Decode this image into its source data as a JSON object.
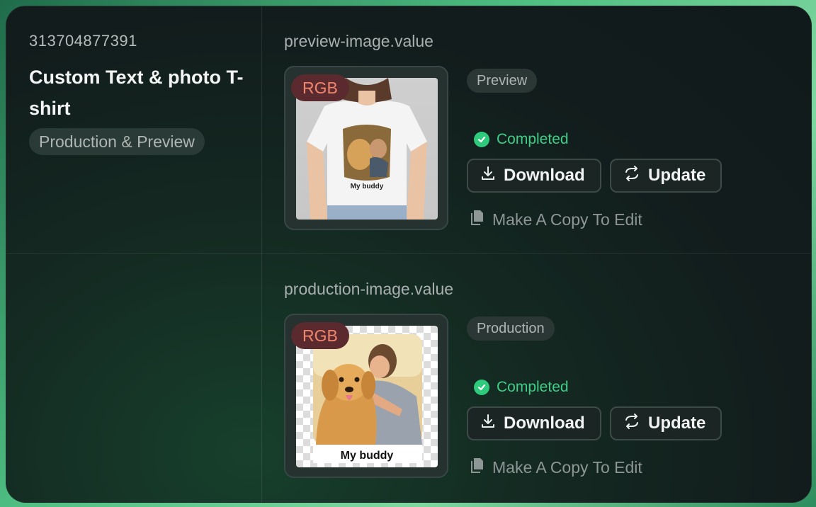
{
  "product": {
    "id": "313704877391",
    "title": "Custom Text & photo T-shirt",
    "tag": "Production & Preview"
  },
  "sections": [
    {
      "label": "preview-image.value",
      "badge": "RGB",
      "type_tag": "Preview",
      "status": "Completed",
      "download_label": "Download",
      "update_label": "Update",
      "copy_label": "Make A Copy To Edit",
      "image_caption": "My buddy"
    },
    {
      "label": "production-image.value",
      "badge": "RGB",
      "type_tag": "Production",
      "status": "Completed",
      "download_label": "Download",
      "update_label": "Update",
      "copy_label": "Make A Copy To Edit",
      "image_caption": "My buddy"
    }
  ],
  "colors": {
    "accent_green": "#3fcf87",
    "badge_bg": "#5a2a2e",
    "badge_text": "#f0876f"
  },
  "icons": {
    "status": "check-circle-icon",
    "download": "download-icon",
    "update": "refresh-icon",
    "copy": "copy-icon"
  }
}
